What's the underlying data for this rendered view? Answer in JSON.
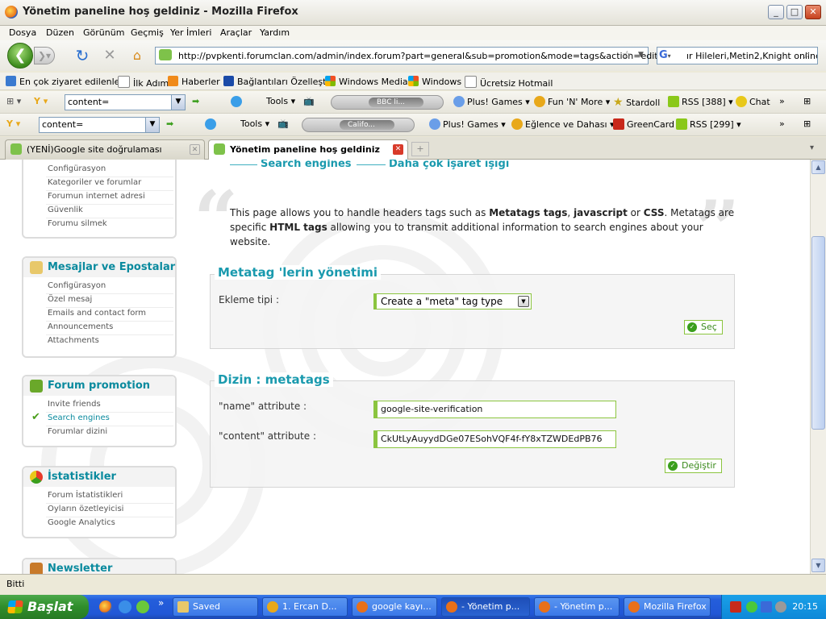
{
  "window": {
    "title": "Yönetim paneline hoş geldiniz - Mozilla Firefox"
  },
  "menu": [
    "Dosya",
    "Düzen",
    "Görünüm",
    "Geçmiş",
    "Yer İmleri",
    "Araçlar",
    "Yardım"
  ],
  "address": {
    "url": "http://pvpkenti.forumclan.com/admin/index.forum?part=general&sub=promotion&mode=tags&action=edit_tag8"
  },
  "search": {
    "value": "ır Hileleri,Metin2,Knight online"
  },
  "bookmarks": [
    "En çok ziyaret edilenler",
    "İlk Adım",
    "Haberler",
    "Bağlantıları Özelleştir",
    "Windows Media",
    "Windows",
    "Ücretsiz Hotmail"
  ],
  "toolbar1": {
    "combo": "content=",
    "tools": "Tools",
    "media_text": "BBC li...",
    "plus_games": "Plus! Games",
    "fun_more": "Fun 'N' More",
    "stardoll": "Stardoll",
    "rss": "RSS [388]",
    "chat": "Chat"
  },
  "toolbar2": {
    "combo": "content=",
    "tools": "Tools",
    "media_text": "Califo...",
    "plus_games": "Plus! Games",
    "eglence": "Eğlence ve Dahası",
    "greencard": "GreenCard",
    "rss": "RSS [299]"
  },
  "tabs": [
    {
      "label": "(YENİ)Google site doğrulaması"
    },
    {
      "label": "Yönetim paneline hoş geldiniz"
    }
  ],
  "sidebar": {
    "group1_items": [
      "Configürasyon",
      "Kategoriler ve forumlar",
      "Forumun internet adresi",
      "Güvenlik",
      "Forumu silmek"
    ],
    "group2": {
      "title": "Mesajlar ve Epostalar",
      "items": [
        "Configürasyon",
        "Özel mesaj",
        "Emails and contact form",
        "Announcements",
        "Attachments"
      ]
    },
    "group3": {
      "title": "Forum promotion",
      "items": [
        "Invite friends",
        "Search engines",
        "Forumlar dizini"
      ]
    },
    "group4": {
      "title": "İstatistikler",
      "items": [
        "Forum İstatistikleri",
        "Oyların özetleyicisi",
        "Google Analytics"
      ]
    },
    "group5": {
      "title": "Newsletter"
    }
  },
  "breadcrumb": {
    "item1": "Search engines",
    "item2": "Daha çok işaret ışığı"
  },
  "description": {
    "p1": "This page allows you to handle headers tags such as ",
    "b1": "Metatags tags",
    "p2": ", ",
    "b2": "javascript",
    "p3": " or ",
    "b3": "CSS",
    "p4": ". Metatags are specific ",
    "b4": "HTML tags",
    "p5": " allowing you to transmit additional information to search engines about your website."
  },
  "metatag_section": {
    "legend": "Metatag 'lerin yönetimi",
    "label": "Ekleme tipi :",
    "select_value": "Create a \"meta\" tag type",
    "button": "Seç"
  },
  "dizin_section": {
    "legend": "Dizin  :  metatags",
    "name_label": "\"name\" attribute :",
    "name_value": "google-site-verification",
    "content_label": "\"content\" attribute :",
    "content_value": "CkUtLyAuyydDGe07ESohVQF4f-fY8xTZWDEdPB76",
    "button": "Değiştir"
  },
  "status": {
    "text": "Bitti"
  },
  "taskbar": {
    "start": "Başlat",
    "items": [
      "Saved",
      "1. Ercan D...",
      "google kayı...",
      "- Yönetim p...",
      "- Yönetim p...",
      "Mozilla Firefox"
    ],
    "clock": "20:15"
  }
}
